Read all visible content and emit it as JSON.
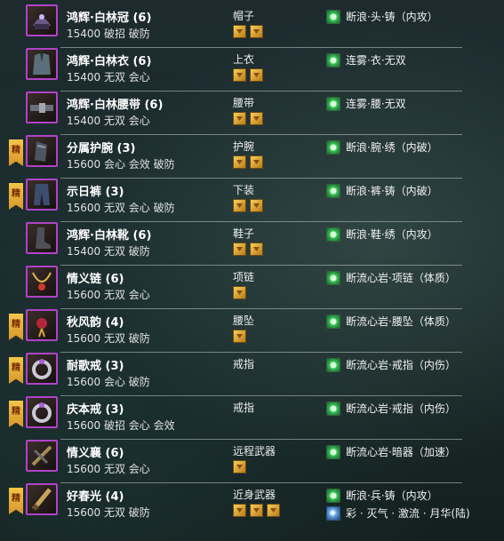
{
  "items": [
    {
      "name": "鸿辉·白林冠 (6)",
      "attrs": "15400 破招 破防",
      "slot": "帽子",
      "gems": 2,
      "badge": false,
      "badge_label": "",
      "icon": "hat-icon",
      "enchant": "断浪·头·铸（内攻）"
    },
    {
      "name": "鸿辉·白林衣 (6)",
      "attrs": "15400 无双 会心",
      "slot": "上衣",
      "gems": 2,
      "badge": false,
      "badge_label": "",
      "icon": "robe-icon",
      "enchant": "连雾·衣·无双"
    },
    {
      "name": "鸿辉·白林腰带 (6)",
      "attrs": "15400 无双 会心",
      "slot": "腰带",
      "gems": 2,
      "badge": false,
      "badge_label": "",
      "icon": "belt-icon",
      "enchant": "连雾·腰·无双"
    },
    {
      "name": "分属护腕 (3)",
      "attrs": "15600 会心 会效 破防",
      "slot": "护腕",
      "gems": 2,
      "badge": true,
      "badge_label": "精",
      "icon": "bracer-icon",
      "enchant": "断浪·腕·绣（内破）"
    },
    {
      "name": "示日裤 (3)",
      "attrs": "15600 无双 会心 破防",
      "slot": "下装",
      "gems": 2,
      "badge": true,
      "badge_label": "精",
      "icon": "pants-icon",
      "enchant": "断浪·裤·铸（内破）"
    },
    {
      "name": "鸿辉·白林靴 (6)",
      "attrs": "15400 无双 破防",
      "slot": "鞋子",
      "gems": 2,
      "badge": false,
      "badge_label": "",
      "icon": "boots-icon",
      "enchant": "断浪·鞋·绣（内攻）"
    },
    {
      "name": "情义链 (6)",
      "attrs": "15600 无双 会心",
      "slot": "项链",
      "gems": 1,
      "badge": false,
      "badge_label": "",
      "icon": "necklace-icon",
      "enchant": "断流心岩·项链（体质）"
    },
    {
      "name": "秋风韵 (4)",
      "attrs": "15600 无双 破防",
      "slot": "腰坠",
      "gems": 1,
      "badge": true,
      "badge_label": "精",
      "icon": "pendant-icon",
      "enchant": "断流心岩·腰坠（体质）"
    },
    {
      "name": "耐歌戒 (3)",
      "attrs": "15600 会心 破防",
      "slot": "戒指",
      "gems": 0,
      "badge": true,
      "badge_label": "精",
      "icon": "ring-icon",
      "enchant": "断流心岩·戒指（内伤）"
    },
    {
      "name": "庆本戒 (3)",
      "attrs": "15600 破招 会心 会效",
      "slot": "戒指",
      "gems": 0,
      "badge": true,
      "badge_label": "精",
      "icon": "ring-icon",
      "enchant": "断流心岩·戒指（内伤）"
    },
    {
      "name": "情义襄 (6)",
      "attrs": "15600 无双 会心",
      "slot": "远程武器",
      "gems": 1,
      "badge": false,
      "badge_label": "",
      "icon": "ranged-weapon-icon",
      "enchant": "断流心岩·暗器（加速）"
    },
    {
      "name": "好春光 (4)",
      "attrs": "15600 无双 破防",
      "slot": "近身武器",
      "gems": 3,
      "badge": true,
      "badge_label": "精",
      "icon": "melee-weapon-icon",
      "enchant": "断浪·兵·铸（内攻）",
      "enchant2": "彩 · 灭气 · 激流 · 月华(陆)"
    }
  ],
  "colors": {
    "border_purple": "#b043c8",
    "gem_gold": "#f6cf5a",
    "enchant_green": "#3ac45a",
    "badge_gold": "#f2c64a"
  }
}
